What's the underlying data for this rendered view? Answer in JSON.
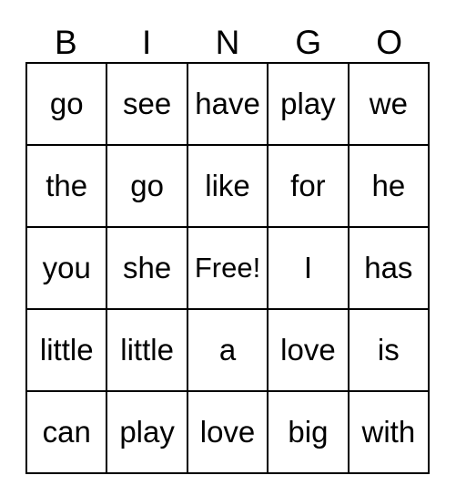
{
  "card": {
    "title": "BINGO",
    "headers": [
      "B",
      "I",
      "N",
      "G",
      "O"
    ],
    "free_label": "Free!",
    "rows": [
      [
        "go",
        "see",
        "have",
        "play",
        "we"
      ],
      [
        "the",
        "go",
        "like",
        "for",
        "he"
      ],
      [
        "you",
        "she",
        "Free!",
        "I",
        "has"
      ],
      [
        "little",
        "little",
        "a",
        "love",
        "is"
      ],
      [
        "can",
        "play",
        "love",
        "big",
        "with"
      ]
    ],
    "colors": {
      "border": "#000000",
      "background": "#ffffff",
      "text": "#000000"
    }
  }
}
